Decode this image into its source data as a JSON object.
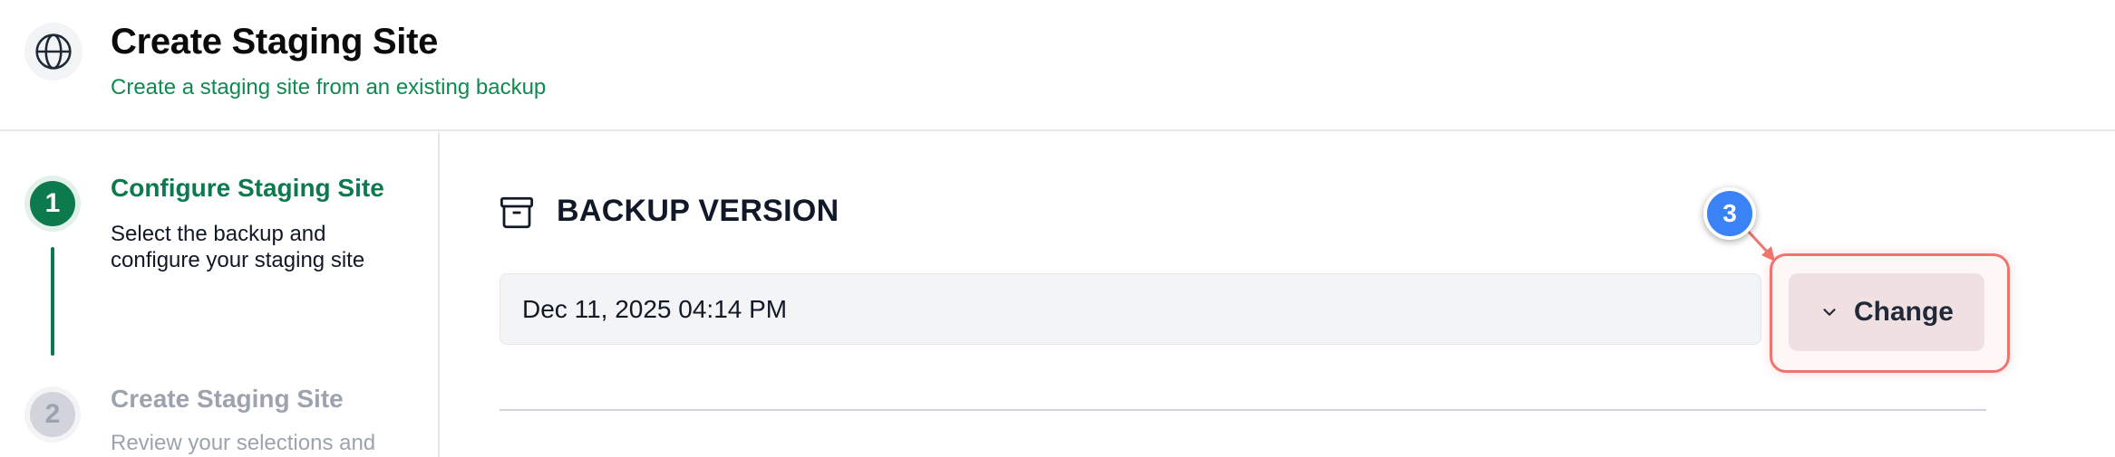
{
  "header": {
    "icon": "globe-icon",
    "title": "Create Staging Site",
    "subtitle": "Create a staging site from an existing backup"
  },
  "steps": [
    {
      "number": "1",
      "title": "Configure Staging Site",
      "description": "Select the backup and configure your staging site",
      "state": "active"
    },
    {
      "number": "2",
      "title": "Create Staging Site",
      "description": "Review your selections and",
      "state": "inactive"
    }
  ],
  "main": {
    "section_icon": "archive-box-icon",
    "section_title": "BACKUP VERSION",
    "backup_value": "Dec 11, 2025 04:14 PM",
    "change_button_label": "Change",
    "change_button_icon": "chevron-down-icon"
  },
  "annotation": {
    "badge": "3",
    "highlight_color": "#ef7470",
    "badge_color": "#3b82f6"
  },
  "colors": {
    "accent": "#0d7a4e",
    "subtitle": "#0f8a4f",
    "muted": "#9ca3af"
  }
}
